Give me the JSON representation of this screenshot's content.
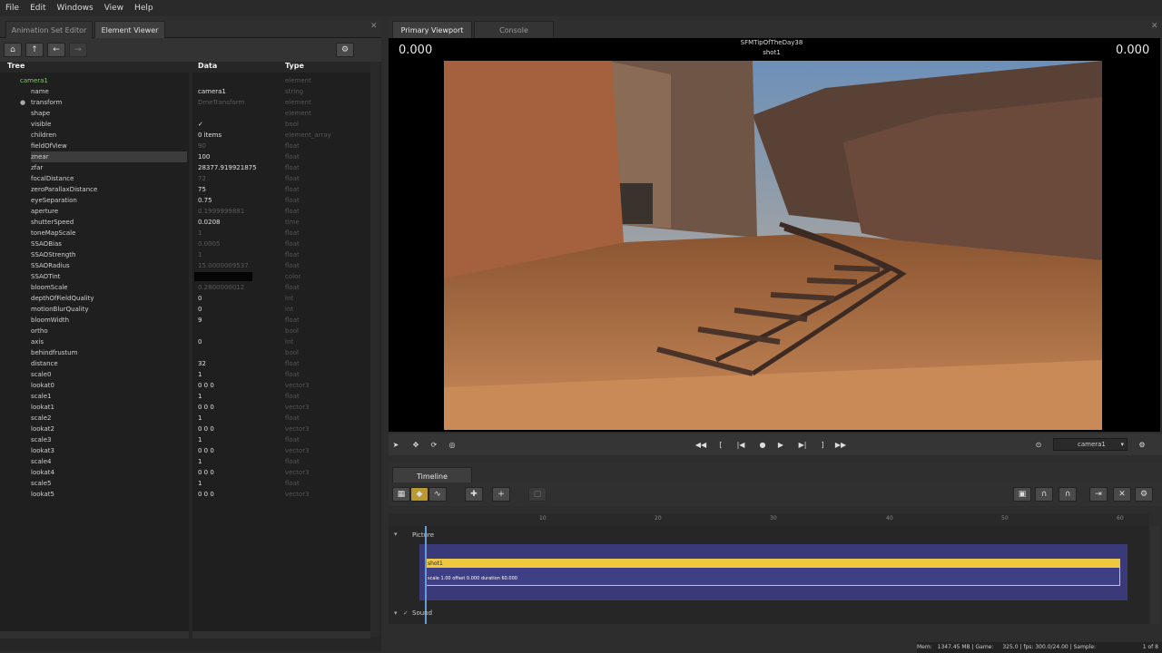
{
  "menu": [
    "File",
    "Edit",
    "Windows",
    "View",
    "Help"
  ],
  "left_tabs": {
    "anim": "Animation Set Editor",
    "viewer": "Element Viewer"
  },
  "columns": {
    "tree": "Tree",
    "data": "Data",
    "type": "Type"
  },
  "tree_rows": [
    {
      "name": "camera1",
      "data": "",
      "type": "element",
      "depth": 0
    },
    {
      "name": "name",
      "data": "camera1",
      "type": "string",
      "depth": 1
    },
    {
      "name": "transform",
      "data": "DmeTransform",
      "type": "element",
      "depth": 1
    },
    {
      "name": "shape",
      "data": "",
      "type": "element",
      "depth": 1
    },
    {
      "name": "visible",
      "data": "✓",
      "type": "bool",
      "depth": 1
    },
    {
      "name": "children",
      "data": "0 items",
      "type": "element_array",
      "depth": 1
    },
    {
      "name": "fieldOfView",
      "data": "90",
      "type": "float",
      "depth": 1
    },
    {
      "name": "znear",
      "data": "100",
      "type": "float",
      "depth": 1
    },
    {
      "name": "zfar",
      "data": "28377.919921875",
      "type": "float",
      "depth": 1
    },
    {
      "name": "focalDistance",
      "data": "72",
      "type": "float",
      "depth": 1
    },
    {
      "name": "zeroParallaxDistance",
      "data": "75",
      "type": "float",
      "depth": 1
    },
    {
      "name": "eyeSeparation",
      "data": "0.75",
      "type": "float",
      "depth": 1
    },
    {
      "name": "aperture",
      "data": "0.1999999881",
      "type": "float",
      "depth": 1
    },
    {
      "name": "shutterSpeed",
      "data": "0.0208",
      "type": "time",
      "depth": 1
    },
    {
      "name": "toneMapScale",
      "data": "1",
      "type": "float",
      "depth": 1
    },
    {
      "name": "SSAOBias",
      "data": "0.0005",
      "type": "float",
      "depth": 1
    },
    {
      "name": "SSAOStrength",
      "data": "1",
      "type": "float",
      "depth": 1
    },
    {
      "name": "SSAORadius",
      "data": "15.0000009537",
      "type": "float",
      "depth": 1
    },
    {
      "name": "SSAOTint",
      "data": "",
      "type": "color",
      "depth": 1
    },
    {
      "name": "bloomScale",
      "data": "0.2800000012",
      "type": "float",
      "depth": 1
    },
    {
      "name": "depthOfFieldQuality",
      "data": "0",
      "type": "int",
      "depth": 1
    },
    {
      "name": "motionBlurQuality",
      "data": "0",
      "type": "int",
      "depth": 1
    },
    {
      "name": "bloomWidth",
      "data": "9",
      "type": "float",
      "depth": 1
    },
    {
      "name": "ortho",
      "data": "",
      "type": "bool",
      "depth": 1
    },
    {
      "name": "axis",
      "data": "0",
      "type": "int",
      "depth": 1
    },
    {
      "name": "behindfrustum",
      "data": "",
      "type": "bool",
      "depth": 1
    },
    {
      "name": "distance",
      "data": "32",
      "type": "float",
      "depth": 1
    },
    {
      "name": "scale0",
      "data": "1",
      "type": "float",
      "depth": 1
    },
    {
      "name": "lookat0",
      "data": "0 0 0",
      "type": "vector3",
      "depth": 1
    },
    {
      "name": "scale1",
      "data": "1",
      "type": "float",
      "depth": 1
    },
    {
      "name": "lookat1",
      "data": "0 0 0",
      "type": "vector3",
      "depth": 1
    },
    {
      "name": "scale2",
      "data": "1",
      "type": "float",
      "depth": 1
    },
    {
      "name": "lookat2",
      "data": "0 0 0",
      "type": "vector3",
      "depth": 1
    },
    {
      "name": "scale3",
      "data": "1",
      "type": "float",
      "depth": 1
    },
    {
      "name": "lookat3",
      "data": "0 0 0",
      "type": "vector3",
      "depth": 1
    },
    {
      "name": "scale4",
      "data": "1",
      "type": "float",
      "depth": 1
    },
    {
      "name": "lookat4",
      "data": "0 0 0",
      "type": "vector3",
      "depth": 1
    },
    {
      "name": "scale5",
      "data": "1",
      "type": "float",
      "depth": 1
    },
    {
      "name": "lookat5",
      "data": "0 0 0",
      "type": "vector3",
      "depth": 1
    }
  ],
  "viewport": {
    "tab_primary": "Primary Viewport",
    "tab_console": "Console",
    "title": "SFMTipOfTheDay38",
    "shot": "shot1",
    "time_left": "0.000",
    "time_right": "0.000"
  },
  "transport": {
    "camera": "camera1"
  },
  "timeline": {
    "tab": "Timeline",
    "track_picture": "Picture",
    "track_sound": "Sound",
    "clip_name": "shot1",
    "clip_info": "scale 1.00 offset 0.000 duration 60.000",
    "ticks": [
      "10",
      "20",
      "30",
      "40",
      "50",
      "60"
    ]
  },
  "status": {
    "mem": "Mem:",
    "mem_val": "1347.45 MB",
    "game": "Game:",
    "game_val": "325.0",
    "fps": "fps:",
    "fps_val": "300.0/24.00",
    "sample": "Sample:",
    "page": "1 of 8"
  }
}
